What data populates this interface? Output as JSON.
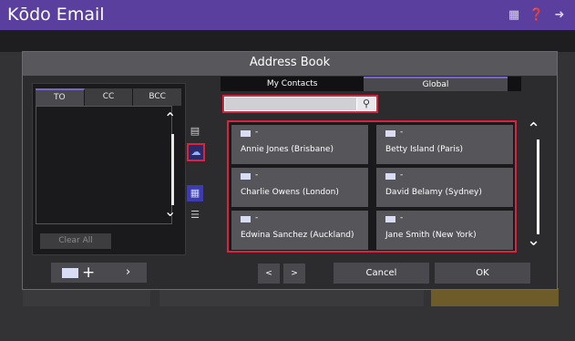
{
  "app": {
    "title": "Kōdo Email"
  },
  "topbar": {
    "icons": [
      "address-book-icon",
      "help-icon",
      "logout-icon"
    ]
  },
  "dialog": {
    "title": "Address Book",
    "recipient_tabs": [
      "TO",
      "CC",
      "BCC"
    ],
    "clear_all": "Clear All",
    "view_tabs": [
      "My Contacts",
      "Global"
    ],
    "search": {
      "value": "",
      "placeholder": ""
    },
    "contacts": [
      {
        "email": "-",
        "name": "Annie Jones (Brisbane)"
      },
      {
        "email": "-",
        "name": "Betty Island (Paris)"
      },
      {
        "email": "-",
        "name": "Charlie Owens (London)"
      },
      {
        "email": "-",
        "name": "David Belamy (Sydney)"
      },
      {
        "email": "-",
        "name": "Edwina Sanchez (Auckland)"
      },
      {
        "email": "-",
        "name": "Jane Smith (New York)"
      }
    ],
    "prev": "<",
    "next": ">",
    "cancel": "Cancel",
    "ok": "OK"
  },
  "colors": {
    "topbar": "#5b3f9e",
    "highlight": "#d9243f",
    "accent": "#7a65c8"
  }
}
